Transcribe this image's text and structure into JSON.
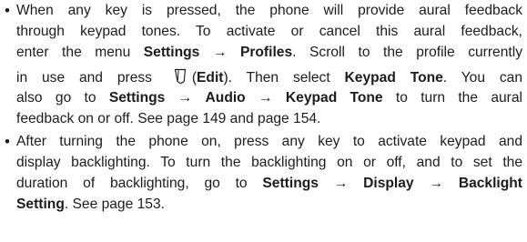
{
  "bullets": [
    {
      "marker": "•",
      "lines": [
        {
          "parts": [
            "When any key is pressed, the phone will provide aural feedback"
          ]
        },
        {
          "parts": [
            "through keypad tones. To activate or cancel this aural feedback,"
          ]
        },
        {
          "parts": [
            "enter the menu ",
            "Settings",
            " → ",
            "Profiles",
            ". Scroll to the profile currently"
          ]
        },
        {
          "parts": [
            "in use and press ",
            "(",
            "Edit",
            "). Then select ",
            "Keypad Tone",
            ". You can"
          ]
        },
        {
          "parts": [
            "also go to ",
            "Settings",
            " → ",
            "Audio",
            " → ",
            "Keypad Tone",
            " to turn the aural"
          ]
        },
        {
          "parts": [
            "feedback on or off. See page 149 and page 154."
          ]
        }
      ]
    },
    {
      "marker": "•",
      "lines": [
        {
          "parts": [
            "After turning the phone on, press any key to activate keypad and"
          ]
        },
        {
          "parts": [
            "display backlighting. To turn the backlighting on or off, and to set the"
          ]
        },
        {
          "parts": [
            "duration of backlighting, go to ",
            "Settings",
            " → ",
            "Display",
            " → ",
            "Backlight"
          ]
        },
        {
          "parts": [
            "Setting",
            ". See page 153."
          ]
        }
      ]
    }
  ],
  "icons": {
    "edit_key": "edit-softkey-icon"
  }
}
